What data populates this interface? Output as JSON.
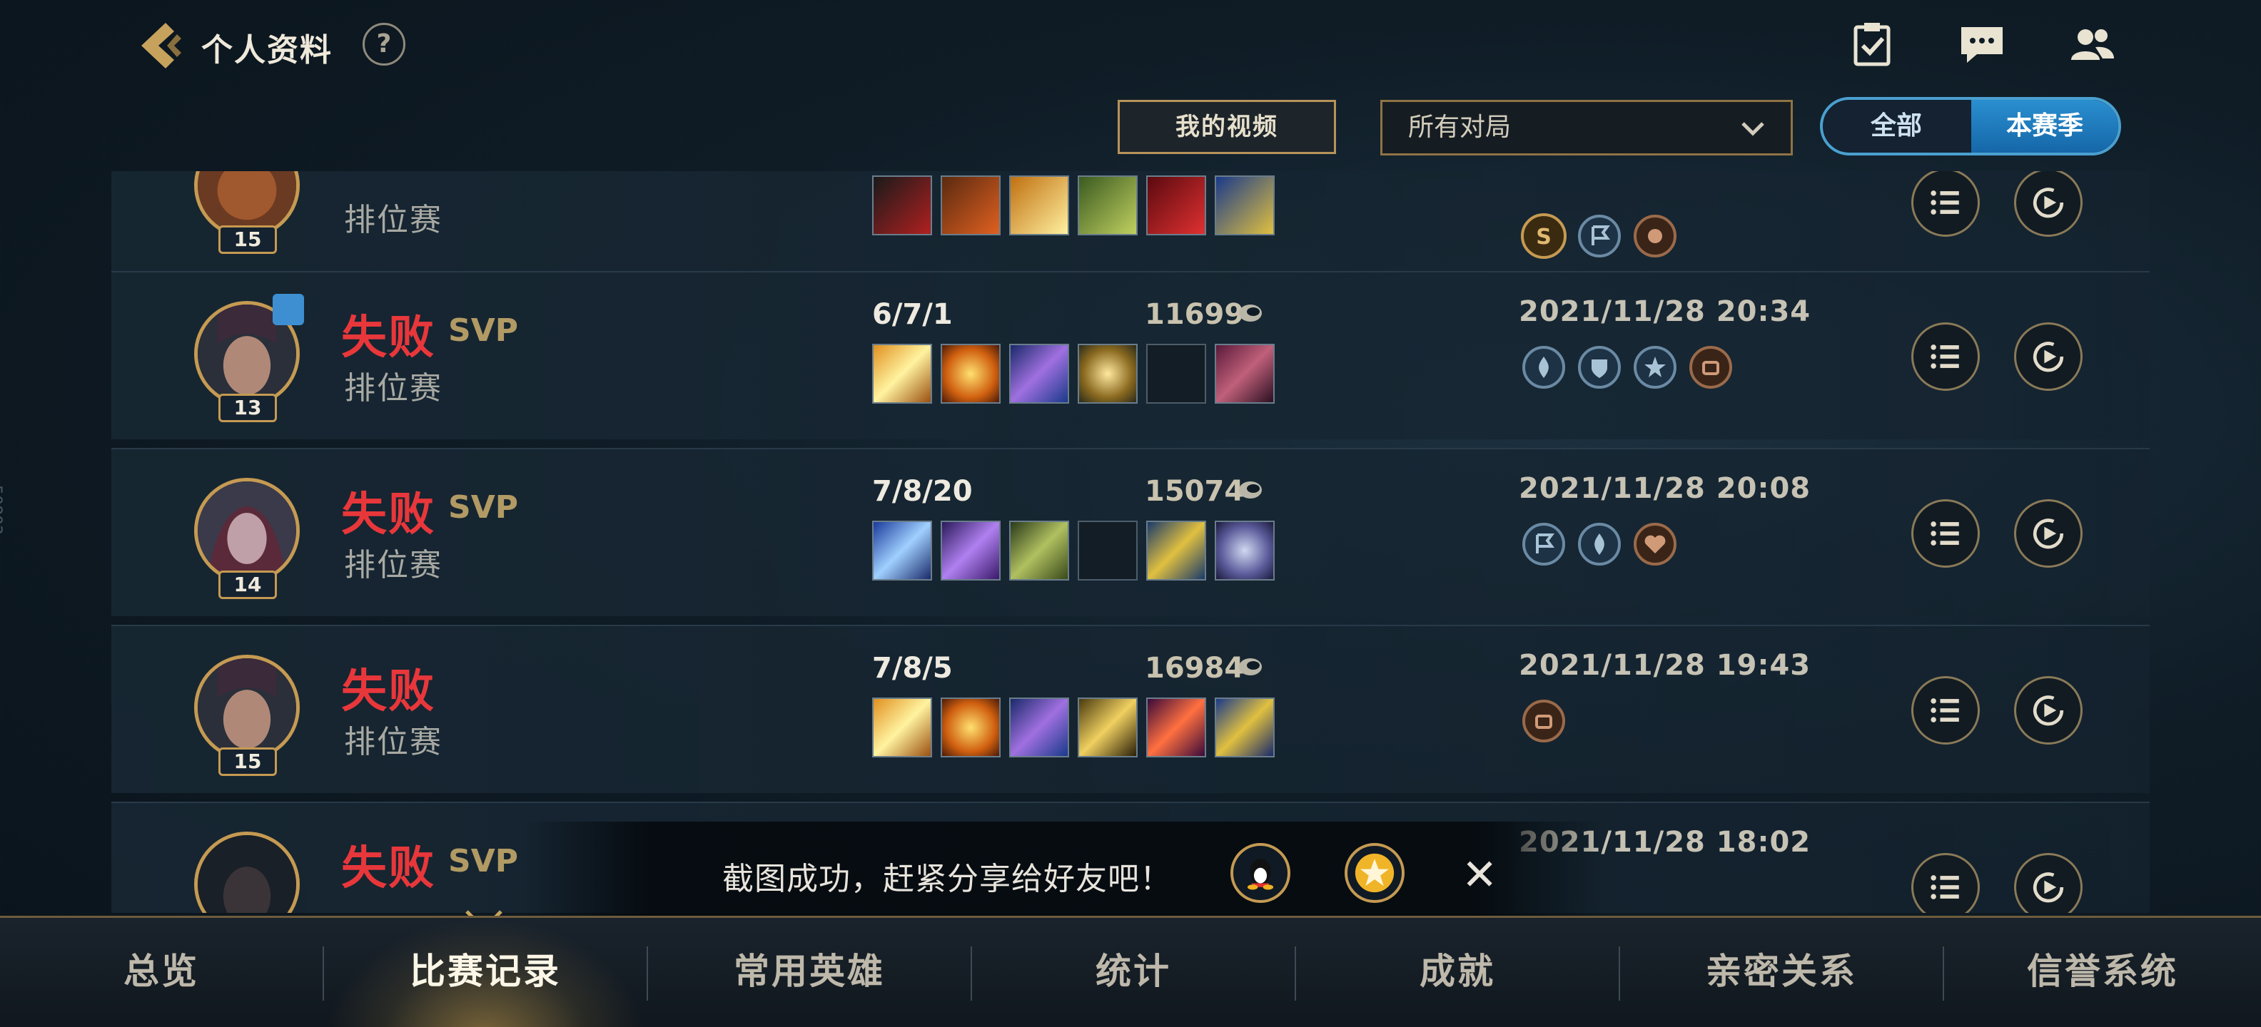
{
  "header": {
    "title": "个人资料",
    "help": "?"
  },
  "filters": {
    "my_videos": "我的视频",
    "match_type": "所有对局",
    "season_options": [
      "全部",
      "本赛季"
    ],
    "season_selected": "本赛季"
  },
  "side_tag": "50803",
  "matches": [
    {
      "partial": "top",
      "level": "15",
      "mode": "排位赛",
      "badges": [
        "s-rank-icon",
        "flag-medal-icon",
        "fist-medal-icon"
      ]
    },
    {
      "result": "失败",
      "svp": "SVP",
      "mode": "排位赛",
      "level": "13",
      "kda": "6/7/1",
      "gold": "11699",
      "timestamp": "2021/11/28 20:34",
      "items": [
        "blade-item",
        "gauntlet-item",
        "blue-crossbow-item",
        "golden-spear-item",
        "empty-slot",
        "boots-item"
      ],
      "badges": [
        "fire-medal-icon",
        "shield-medal-icon",
        "star-medal-icon",
        "coin-medal-icon"
      ]
    },
    {
      "result": "失败",
      "svp": "SVP",
      "mode": "排位赛",
      "level": "14",
      "kda": "7/8/20",
      "gold": "15074",
      "timestamp": "2021/11/28 20:08",
      "items": [
        "ice-spear-item",
        "purple-armor-item",
        "green-crossbow-item",
        "empty-slot",
        "golden-cannon-item",
        "bird-summon-item"
      ],
      "badges": [
        "flag-medal-icon",
        "fire-medal-icon",
        "heart-medal-icon"
      ]
    },
    {
      "result": "失败",
      "svp": "",
      "mode": "排位赛",
      "level": "15",
      "kda": "7/8/5",
      "gold": "16984",
      "timestamp": "2021/11/28 19:43",
      "items": [
        "blade-item",
        "gauntlet-item",
        "blue-crossbow-item",
        "golden-sword-item",
        "flame-sword-item",
        "potion-item"
      ],
      "badges": [
        "coin-medal-icon"
      ]
    },
    {
      "partial": "bottom",
      "result": "失败",
      "svp": "SVP",
      "timestamp": "2021/11/28 18:02"
    }
  ],
  "toast": {
    "message": "截图成功，赶紧分享给好友吧！",
    "close": "✕"
  },
  "nav": {
    "tabs": [
      "总览",
      "比赛记录",
      "常用英雄",
      "统计",
      "成就",
      "亲密关系",
      "信誉系统"
    ],
    "active": "比赛记录"
  },
  "colors": {
    "defeat": "#e8373b",
    "accent_gold": "#c59a52",
    "accent_blue": "#2a8fd0"
  }
}
